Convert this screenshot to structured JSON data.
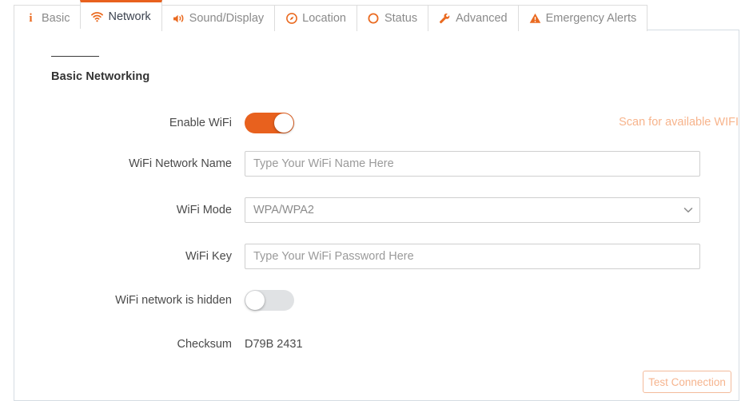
{
  "tabs": [
    {
      "id": "basic",
      "label": "Basic",
      "icon": "info-icon",
      "active": false
    },
    {
      "id": "network",
      "label": "Network",
      "icon": "wifi-icon",
      "active": true
    },
    {
      "id": "sound-display",
      "label": "Sound/Display",
      "icon": "speaker-icon",
      "active": false
    },
    {
      "id": "location",
      "label": "Location",
      "icon": "target-icon",
      "active": false
    },
    {
      "id": "status",
      "label": "Status",
      "icon": "circle-icon",
      "active": false
    },
    {
      "id": "advanced",
      "label": "Advanced",
      "icon": "wrench-icon",
      "active": false
    },
    {
      "id": "emergency-alerts",
      "label": "Emergency Alerts",
      "icon": "warning-icon",
      "active": false
    }
  ],
  "section": {
    "title": "Basic Networking"
  },
  "form": {
    "enable_wifi": {
      "label": "Enable WiFi",
      "state": "on",
      "scan_link": "Scan for available WIFI"
    },
    "network_name": {
      "label": "WiFi Network Name",
      "value": "",
      "placeholder": "Type Your WiFi Name Here"
    },
    "wifi_mode": {
      "label": "WiFi Mode",
      "selected": "WPA/WPA2",
      "options": [
        "WPA/WPA2"
      ]
    },
    "wifi_key": {
      "label": "WiFi Key",
      "value": "",
      "placeholder": "Type Your WiFi Password Here"
    },
    "hidden_network": {
      "label": "WiFi network is hidden",
      "state": "off"
    },
    "checksum": {
      "label": "Checksum",
      "value": "D79B 2431"
    }
  },
  "footer": {
    "test_connection": "Test Connection"
  },
  "colors": {
    "accent": "#e8611e",
    "accent_muted": "#f7b48c",
    "panel_border": "#d5dde3",
    "tab_border": "#dcdcdc",
    "toggle_off": "#e0e2e4"
  }
}
